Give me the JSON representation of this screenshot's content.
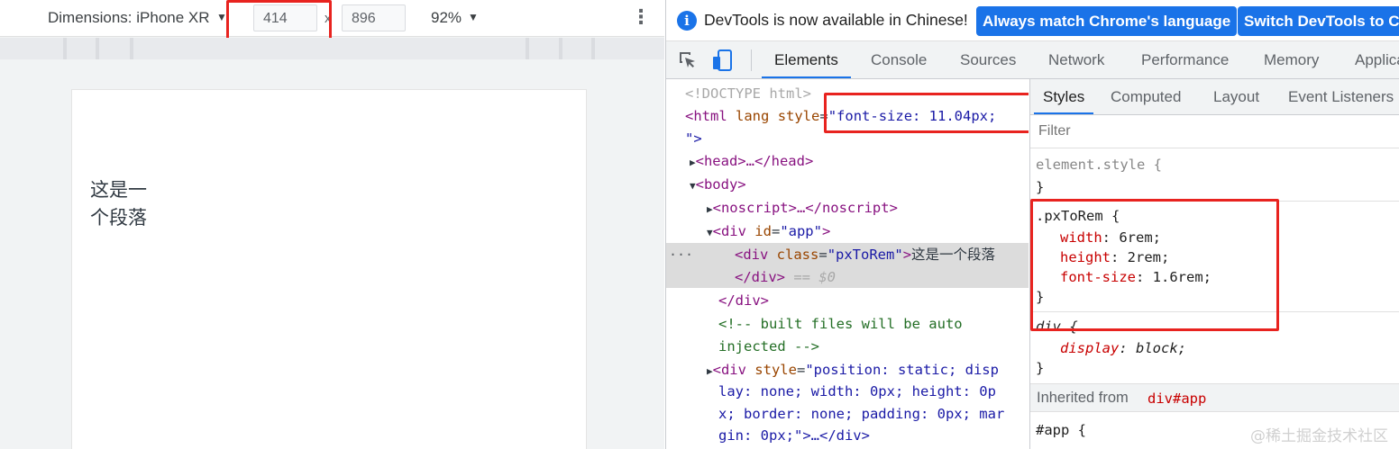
{
  "device_toolbar": {
    "dimensions_label": "Dimensions: iPhone XR",
    "width_value": "414",
    "height_value": "896",
    "times": "x",
    "zoom": "92%",
    "dropdown_glyph": "▼",
    "more_glyph": "⋮"
  },
  "page": {
    "paragraph_line1": "这是一",
    "paragraph_line2": "个段落"
  },
  "infobar": {
    "info_glyph": "i",
    "message": "DevTools is now available in Chinese!",
    "btn_match": "Always match Chrome's language",
    "btn_switch": "Switch DevTools to Chinese"
  },
  "tabs": {
    "elements": "Elements",
    "console": "Console",
    "sources": "Sources",
    "network": "Network",
    "performance": "Performance",
    "memory": "Memory",
    "application": "Application"
  },
  "dom": {
    "doctype": "<!DOCTYPE html>",
    "html_open": "<html",
    "html_lang": "lang",
    "html_style_attr": "style",
    "html_style_val": "\"font-size: 11.04px;",
    "html_close_quote": "\">",
    "head": "<head>…</head>",
    "body": "<body>",
    "noscript": "<noscript>…</noscript>",
    "div_app_open": "<div",
    "div_app_attr": "id",
    "div_app_val": "\"app\"",
    "div_app_close": ">",
    "div_class_open": "<div",
    "div_class_attr": "class",
    "div_class_val": "\"pxToRem\"",
    "div_class_close": ">",
    "div_class_text": "这是一个段落",
    "div_end": "</div>",
    "eq_dollar": "== $0",
    "div_app_end": "</div>",
    "comment_1": "<!-- built files will be auto",
    "comment_2": "injected -->",
    "style_div_open": "<div",
    "style_div_attr": "style",
    "style_div_l1": "\"position: static; disp",
    "style_div_l2": "lay: none; width: 0px; height: 0p",
    "style_div_l3": "x; border: none; padding: 0px; mar",
    "style_div_l4": "gin: 0px;\">…</div>",
    "ellipsis": "···"
  },
  "styles_tabs": {
    "styles": "Styles",
    "computed": "Computed",
    "layout": "Layout",
    "event_listeners": "Event Listeners"
  },
  "styles": {
    "filter_placeholder": "Filter",
    "element_style": "element.style {",
    "close_brace": "}",
    "rule_selector": ".pxToRem {",
    "width_prop": "width",
    "width_val": "6rem;",
    "height_prop": "height",
    "height_val": "2rem;",
    "font_size_prop": "font-size",
    "font_size_val": "1.6rem;",
    "div_selector": "div {",
    "display_prop": "display",
    "display_val": "block;",
    "inherited_label": "Inherited from",
    "inherited_from": "div#app",
    "app_selector": "#app {",
    "watermark": "@稀土掘金技术社区"
  },
  "colors": {
    "accent": "#1a73e8",
    "highlight_box": "#e8231f",
    "selected_row": "#dcdcdc"
  }
}
